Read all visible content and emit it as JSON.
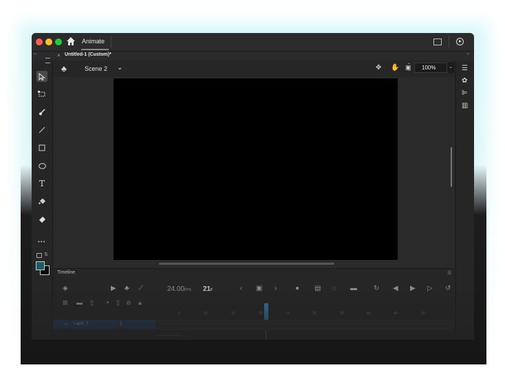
{
  "app": {
    "title": "Animate",
    "document_tab": "Untitled-1 (Custom)*"
  },
  "scene": {
    "label": "Scene 2",
    "zoom": "100%"
  },
  "timeline": {
    "title": "Timeline",
    "fps_value": "24.00",
    "fps_unit": "FPS",
    "current_frame": "21",
    "frame_unit": "F",
    "ruler_ticks": [
      "5",
      "10",
      "15",
      "20",
      "25",
      "30",
      "35",
      "40",
      "45",
      "50"
    ],
    "layer_name": "Layer_1"
  },
  "colors": {
    "fill": "#1a5c66",
    "stroke": "#000000",
    "playhead": "#3a84c4",
    "stage": "#000000"
  },
  "icons": {
    "toolbar": [
      "selection-tool-icon",
      "free-transform-icon",
      "brush-icon",
      "line-icon",
      "rectangle-icon",
      "oval-icon",
      "text-icon",
      "paint-bucket-icon",
      "eraser-icon"
    ]
  }
}
